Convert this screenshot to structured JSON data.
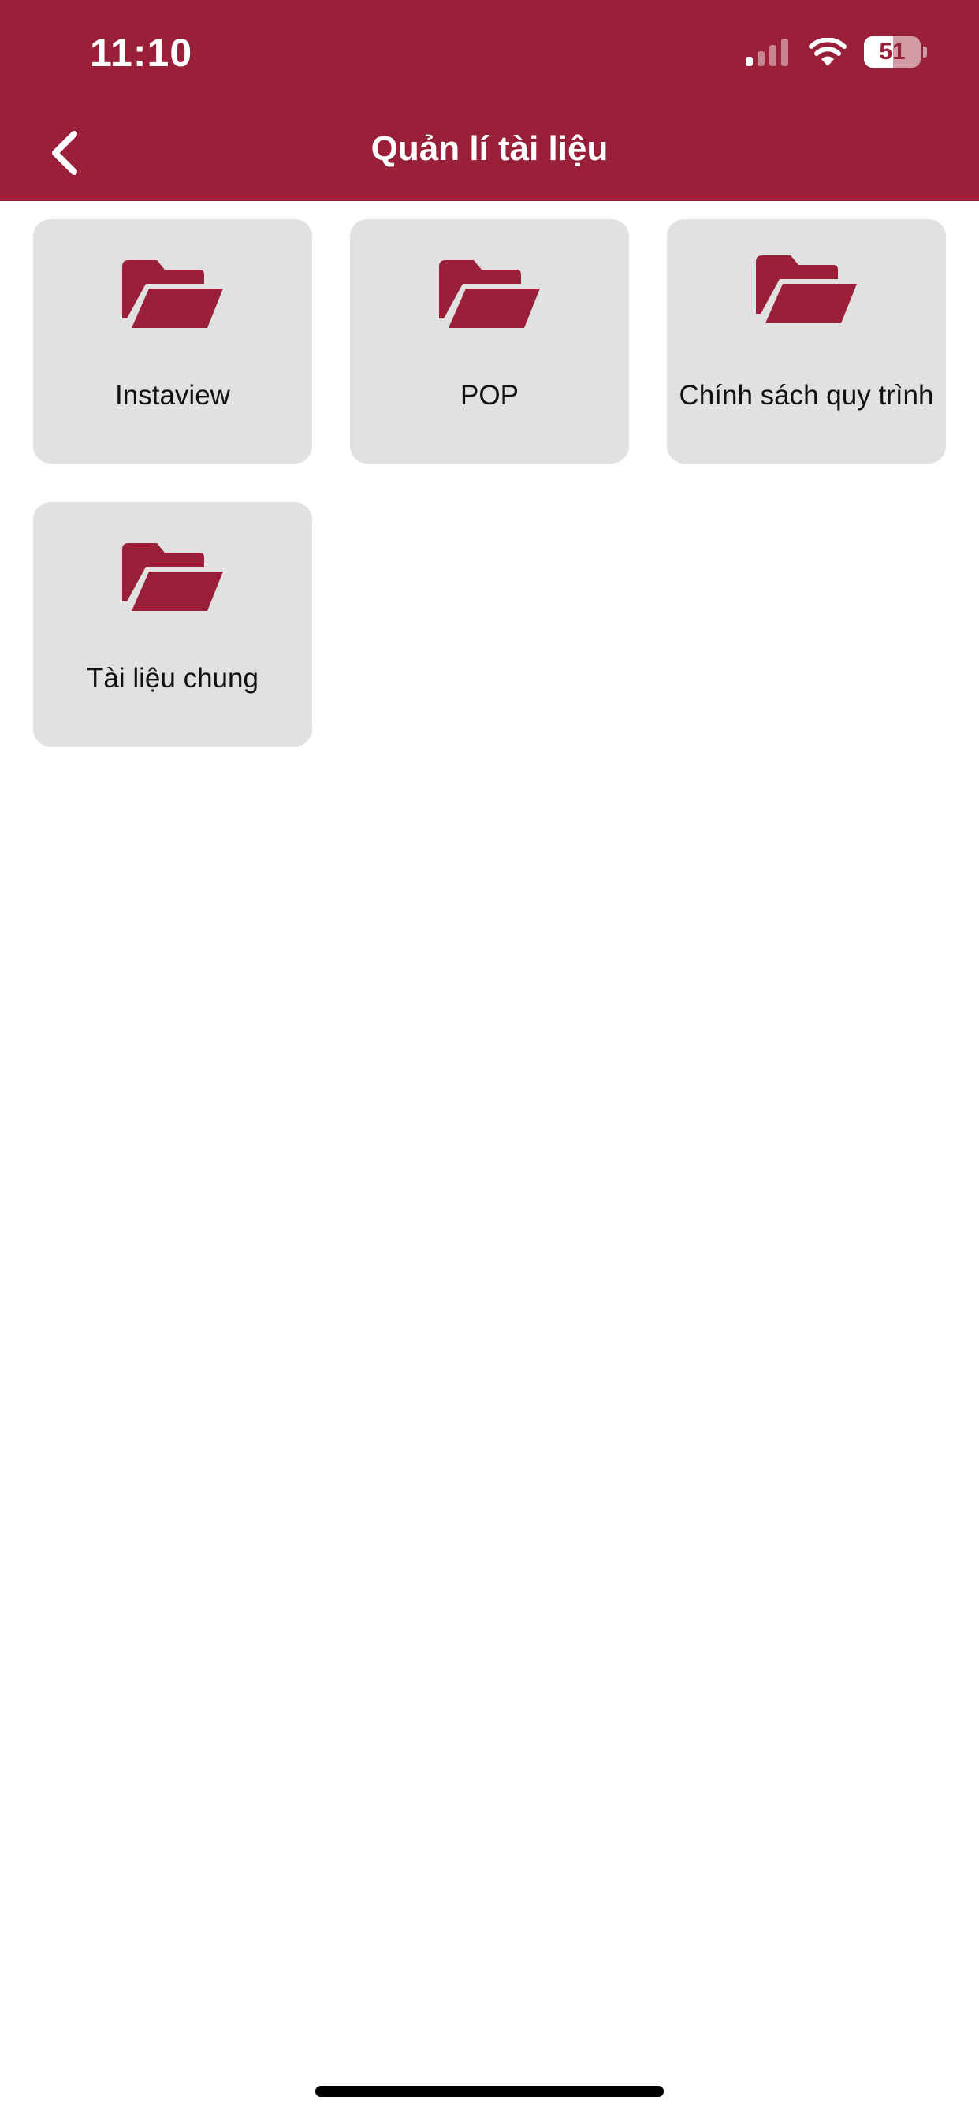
{
  "status_bar": {
    "time": "11:10",
    "battery_level": "51",
    "signal_bars_active": 1,
    "signal_bars_total": 4
  },
  "header": {
    "title": "Quản lí tài liệu",
    "back_icon": "chevron-left-icon"
  },
  "folders": [
    {
      "label": "Instaview",
      "icon": "folder-open-icon"
    },
    {
      "label": "POP",
      "icon": "folder-open-icon"
    },
    {
      "label": "Chính sách quy trình",
      "icon": "folder-open-icon"
    },
    {
      "label": "Tài liệu chung",
      "icon": "folder-open-icon"
    }
  ],
  "colors": {
    "brand": "#9a1f38",
    "card_background": "#e1e1e1",
    "text": "#111111"
  }
}
